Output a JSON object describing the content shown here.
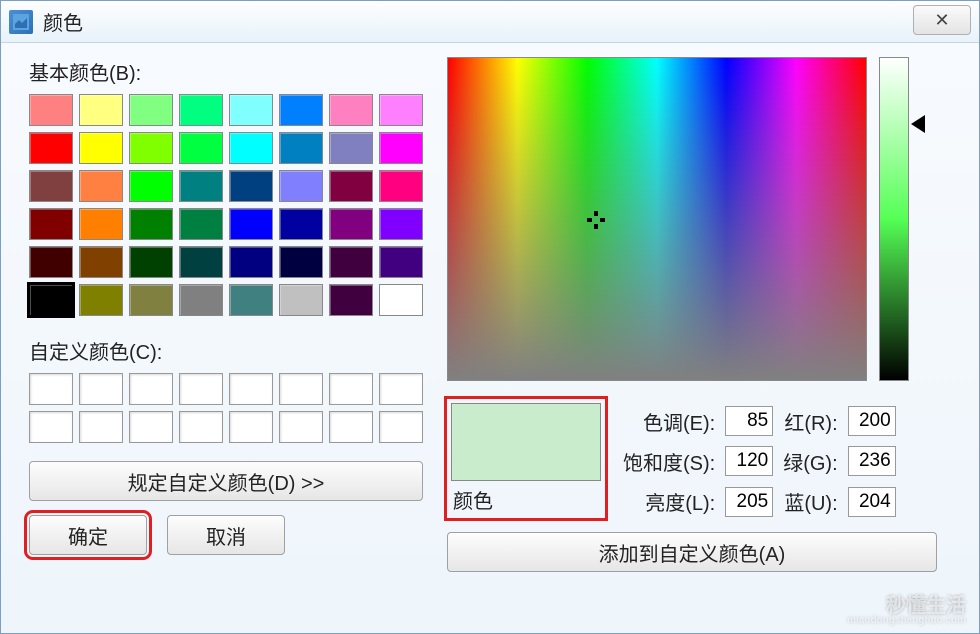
{
  "window": {
    "title": "颜色",
    "close_glyph": "✕"
  },
  "labels": {
    "basic": "基本颜色(B):",
    "custom": "自定义颜色(C):",
    "define": "规定自定义颜色(D) >>",
    "ok": "确定",
    "cancel": "取消",
    "preview": "颜色",
    "add": "添加到自定义颜色(A)",
    "hue": "色调(E):",
    "sat": "饱和度(S):",
    "lum": "亮度(L):",
    "red": "红(R):",
    "green": "绿(G):",
    "blue": "蓝(U):"
  },
  "values": {
    "hue": "85",
    "sat": "120",
    "lum": "205",
    "red": "200",
    "green": "236",
    "blue": "204",
    "preview_color": "#c8eccc"
  },
  "basic_colors": [
    "#ff8080",
    "#ffff80",
    "#80ff80",
    "#00ff80",
    "#80ffff",
    "#0080ff",
    "#ff80c0",
    "#ff80ff",
    "#ff0000",
    "#ffff00",
    "#80ff00",
    "#00ff40",
    "#00ffff",
    "#0080c0",
    "#8080c0",
    "#ff00ff",
    "#804040",
    "#ff8040",
    "#00ff00",
    "#008080",
    "#004080",
    "#8080ff",
    "#800040",
    "#ff0080",
    "#800000",
    "#ff8000",
    "#008000",
    "#008040",
    "#0000ff",
    "#0000a0",
    "#800080",
    "#8000ff",
    "#400000",
    "#804000",
    "#004000",
    "#004040",
    "#000080",
    "#000040",
    "#400040",
    "#400080",
    "#000000",
    "#808000",
    "#808040",
    "#808080",
    "#408080",
    "#c0c0c0",
    "#400040",
    "#ffffff"
  ],
  "selected_basic_index": 40,
  "watermark": {
    "main": "秒懂生活",
    "sub": "miaodongshenghuo.com"
  }
}
